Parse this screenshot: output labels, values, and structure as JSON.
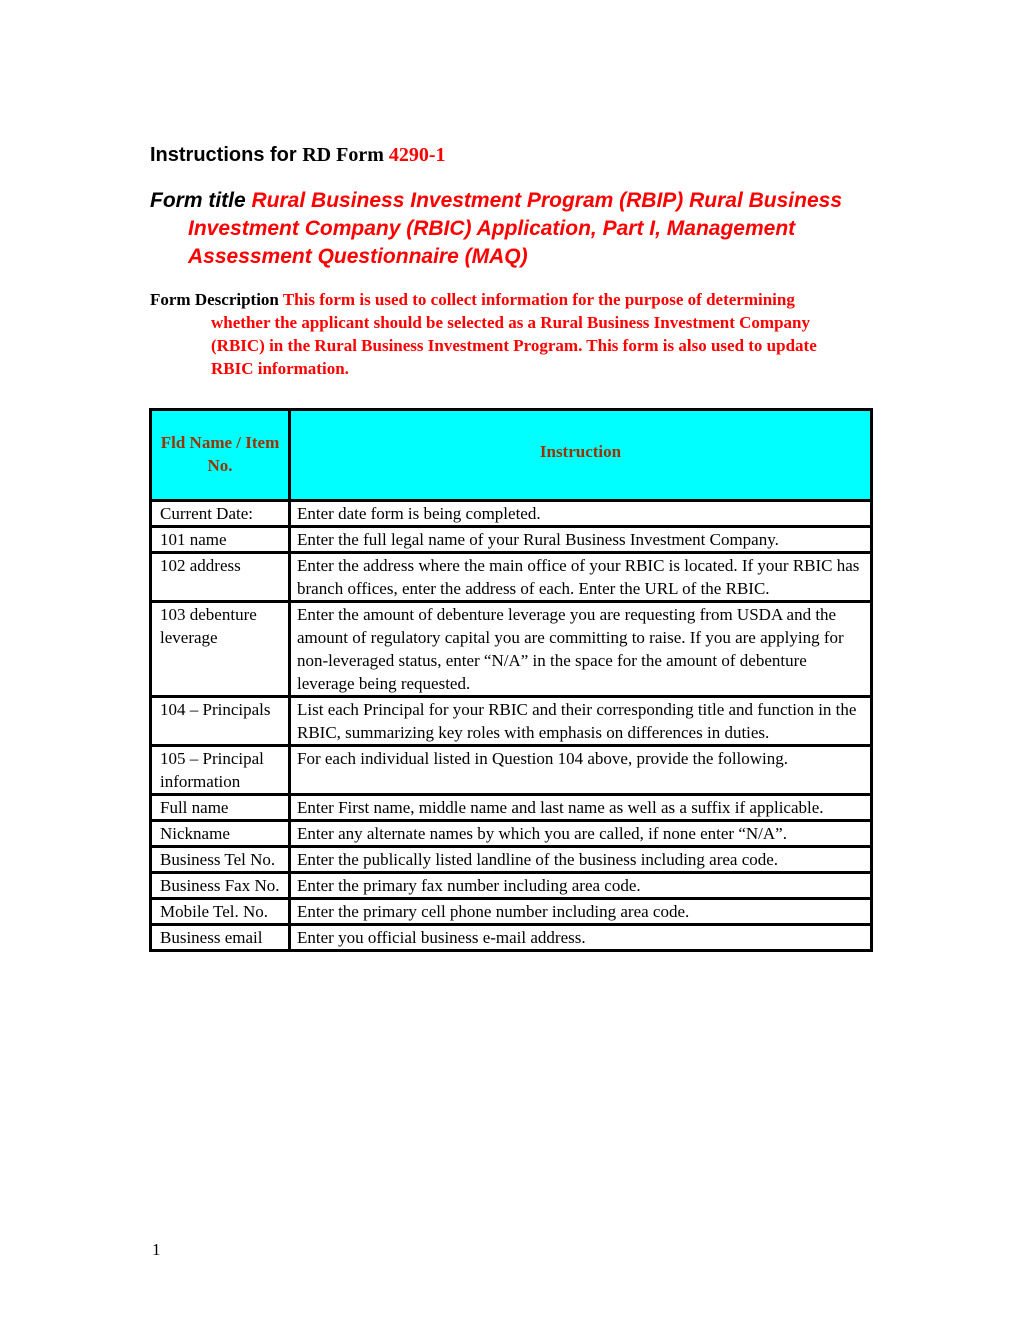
{
  "heading": {
    "prefix": "Instructions for ",
    "form_label": "RD Form ",
    "form_number": "4290-1"
  },
  "form_title": {
    "label": "Form title ",
    "value": "Rural Business Investment Program (RBIP) Rural Business Investment Company (RBIC) Application, Part I, Management Assessment Questionnaire (MAQ)"
  },
  "form_description": {
    "label": "Form Description ",
    "value": "This form is used to collect information for the purpose of determining whether the applicant should be selected as a Rural Business Investment Company (RBIC) in the Rural Business Investment Program. This form is also used to update RBIC information."
  },
  "table": {
    "headers": [
      "Fld Name / Item No.",
      "Instruction"
    ],
    "rows": [
      {
        "field": "Current Date:",
        "instruction": "Enter date form is being completed."
      },
      {
        "field": "101 name",
        "instruction": "Enter the full legal name of your Rural Business Investment Company."
      },
      {
        "field": "102 address",
        "instruction": "Enter the address where the main office of your RBIC is located.  If your RBIC has branch offices, enter the address of each.  Enter the URL of the RBIC."
      },
      {
        "field": "103 debenture leverage",
        "instruction": "Enter the amount of debenture leverage you are requesting from USDA and the amount of regulatory capital you are committing to raise.  If you are applying for non-leveraged status, enter “N/A” in the space for the amount of debenture leverage being requested."
      },
      {
        "field": "104 – Principals",
        "instruction": "List each Principal for your RBIC and their corresponding title and function in the RBIC, summarizing key roles with emphasis on differences in duties."
      },
      {
        "field": "105 – Principal information",
        "instruction": "For each individual listed in Question 104 above, provide the following."
      },
      {
        "field": "Full name",
        "instruction": "Enter First name, middle name and last name as well as a suffix if applicable."
      },
      {
        "field": "Nickname",
        "instruction": "Enter any alternate names by which you are called, if none enter “N/A”."
      },
      {
        "field": "Business Tel No.",
        "instruction": "Enter the publically listed landline of the business including area code."
      },
      {
        "field": "Business Fax No.",
        "instruction": "Enter the primary fax number including area code."
      },
      {
        "field": "Mobile Tel. No.",
        "instruction": "Enter the primary cell phone number including area code."
      },
      {
        "field": "Business email",
        "instruction": "Enter you official business e-mail address."
      }
    ]
  },
  "page_number": "1",
  "colors": {
    "accent_red": "#ff0000",
    "header_bg": "#00ffff",
    "header_text": "#993300"
  }
}
